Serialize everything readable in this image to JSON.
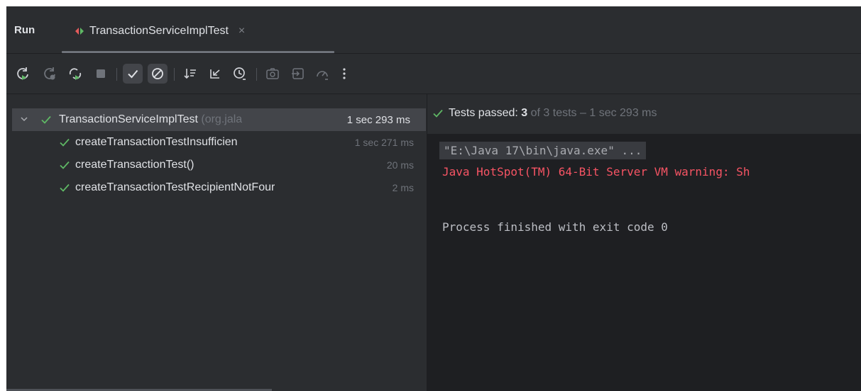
{
  "header": {
    "run_label": "Run",
    "tab_title": "TransactionServiceImplTest",
    "tab_close": "×"
  },
  "toolbar": {
    "buttons": [
      {
        "name": "rerun",
        "icon": "rerun-icon"
      },
      {
        "name": "rerun-failed",
        "icon": "rerun-failed-icon"
      },
      {
        "name": "toggle-auto-test",
        "icon": "auto-test-icon"
      },
      {
        "name": "stop",
        "icon": "stop-icon"
      },
      {
        "name": "show-passed",
        "icon": "check-icon",
        "active": true
      },
      {
        "name": "show-ignored",
        "icon": "ignored-icon",
        "active": true
      },
      {
        "name": "sort",
        "icon": "sort-icon"
      },
      {
        "name": "collapse",
        "icon": "collapse-icon"
      },
      {
        "name": "history",
        "icon": "history-icon"
      },
      {
        "name": "screenshot",
        "icon": "camera-icon"
      },
      {
        "name": "import",
        "icon": "import-icon"
      },
      {
        "name": "coverage",
        "icon": "coverage-icon"
      },
      {
        "name": "more",
        "icon": "more-vertical-icon"
      }
    ]
  },
  "tree": {
    "root": {
      "name": "TransactionServiceImplTest",
      "package": " (org.jala",
      "time": "1 sec 293 ms"
    },
    "items": [
      {
        "name": "createTransactionTestInsufficien",
        "time": "1 sec 271 ms"
      },
      {
        "name": "createTransactionTest()",
        "time": "20 ms"
      },
      {
        "name": "createTransactionTestRecipientNotFour",
        "time": "2 ms"
      }
    ]
  },
  "status": {
    "label": "Tests passed: ",
    "count": "3",
    "rest": " of 3 tests – 1 sec 293 ms"
  },
  "console": {
    "cmd": "\"E:\\Java 17\\bin\\java.exe\" ...",
    "warning": "Java HotSpot(TM) 64-Bit Server VM warning: Sh",
    "exit": "Process finished with exit code 0"
  },
  "colors": {
    "pass_green": "#5fb865",
    "warning_red": "#f75464",
    "background": "#2b2d30",
    "console_bg": "#1e1f22"
  }
}
